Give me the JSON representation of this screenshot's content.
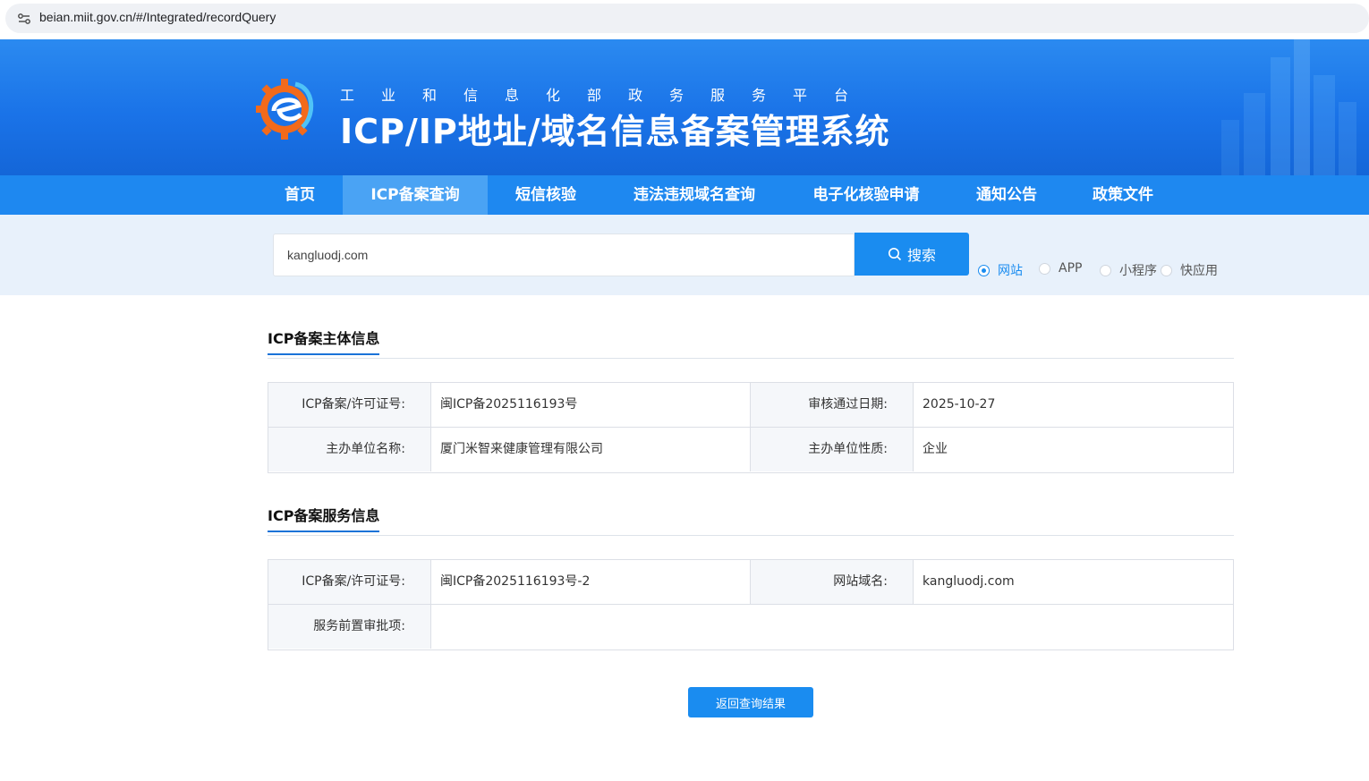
{
  "browser": {
    "url": "beian.miit.gov.cn/#/Integrated/recordQuery"
  },
  "banner": {
    "subtitle": "工业和信息化部政务服务平台",
    "title": "ICP/IP地址/域名信息备案管理系统"
  },
  "nav": {
    "items": [
      {
        "label": "首页"
      },
      {
        "label": "ICP备案查询"
      },
      {
        "label": "短信核验"
      },
      {
        "label": "违法违规域名查询"
      },
      {
        "label": "电子化核验申请"
      },
      {
        "label": "通知公告"
      },
      {
        "label": "政策文件"
      }
    ],
    "active": "ICP备案查询"
  },
  "search": {
    "value": "kangluodj.com",
    "button_label": "搜索",
    "options": [
      {
        "label": "网站",
        "checked": true
      },
      {
        "label": "APP",
        "checked": false
      },
      {
        "label": "小程序",
        "checked": false
      },
      {
        "label": "快应用",
        "checked": false
      }
    ]
  },
  "entity_section": {
    "title": "ICP备案主体信息",
    "license_label": "ICP备案/许可证号:",
    "license_value": "闽ICP备2025116193号",
    "approval_date_label": "审核通过日期:",
    "approval_date_value": "2025-10-27",
    "org_name_label": "主办单位名称:",
    "org_name_value": "厦门米智来健康管理有限公司",
    "org_type_label": "主办单位性质:",
    "org_type_value": "企业"
  },
  "service_section": {
    "title": "ICP备案服务信息",
    "license_label": "ICP备案/许可证号:",
    "license_value": "闽ICP备2025116193号-2",
    "domain_label": "网站域名:",
    "domain_value": "kangluodj.com",
    "preapproval_label": "服务前置审批项:",
    "preapproval_value": ""
  },
  "back_button_label": "返回查询结果",
  "colors": {
    "primary": "#1a8cf0",
    "nav": "#1e88f0",
    "nav_active": "#4aa3f4",
    "search_bg": "#e8f1fb"
  }
}
